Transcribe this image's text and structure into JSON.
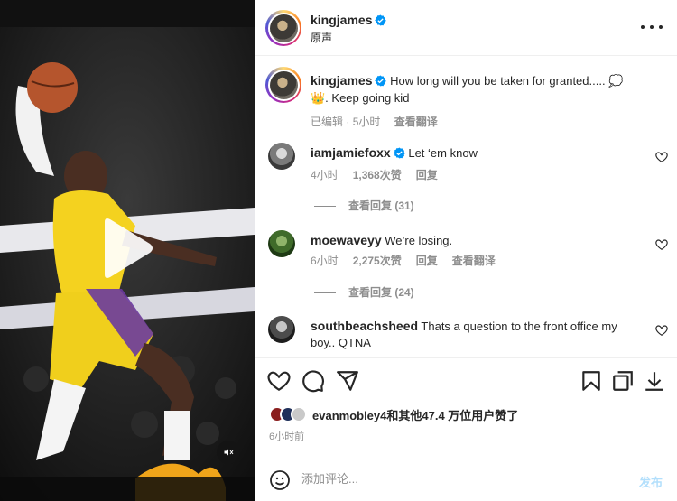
{
  "post": {
    "author": "kingjames",
    "audio": "原声",
    "caption_text": "How long will you be taken for granted..... 💭 👑. Keep going kid",
    "edited": "已编辑",
    "age": "5小时",
    "translate": "查看翻译"
  },
  "comments": [
    {
      "user": "iamjamiefoxx",
      "verified": true,
      "text": "Let ‘em know",
      "age": "4小时",
      "likes": "1,368次赞",
      "reply": "回复",
      "replies": "查看回复 (31)"
    },
    {
      "user": "moewaveyy",
      "verified": false,
      "text": "We’re losing.",
      "age": "6小时",
      "likes": "2,275次赞",
      "reply": "回复",
      "translate": "查看翻译",
      "replies": "查看回复 (24)"
    },
    {
      "user": "southbeachsheed",
      "verified": false,
      "text": "Thats a question to the front office my boy.. QTNA"
    }
  ],
  "likes": {
    "text": "evanmobley4和其他47.4 万位用户赞了",
    "time": "6小时前"
  },
  "composer": {
    "placeholder": "添加评论...",
    "post_label": "发布"
  },
  "colors": {
    "accent": "#0095f6",
    "post_disabled": "#b2dffc",
    "muted": "#8e8e8e"
  },
  "icons": [
    "heart-icon",
    "comment-icon",
    "share-icon",
    "bookmark-icon",
    "copy-icon",
    "download-icon",
    "emoji-icon",
    "play-icon",
    "mute-icon",
    "more-icon"
  ]
}
